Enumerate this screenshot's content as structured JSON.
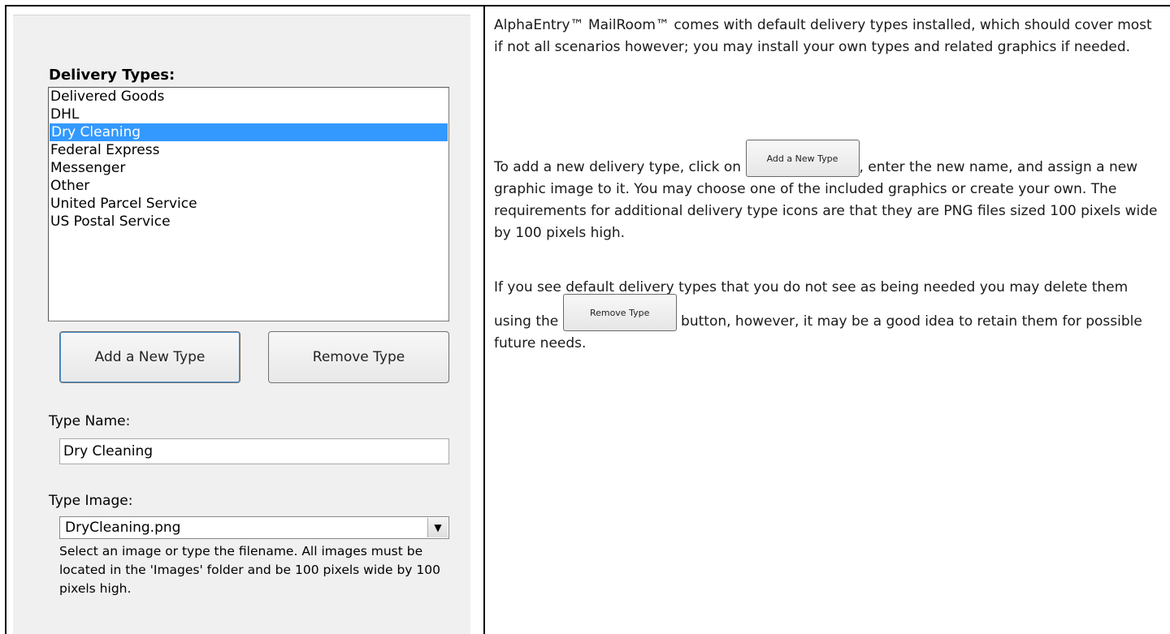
{
  "panel": {
    "delivery_types_label": "Delivery Types:",
    "items": [
      {
        "label": "Delivered Goods",
        "selected": false
      },
      {
        "label": "DHL",
        "selected": false
      },
      {
        "label": "Dry Cleaning",
        "selected": true
      },
      {
        "label": "Federal Express",
        "selected": false
      },
      {
        "label": "Messenger",
        "selected": false
      },
      {
        "label": "Other",
        "selected": false
      },
      {
        "label": "United Parcel Service",
        "selected": false
      },
      {
        "label": "US Postal Service",
        "selected": false
      }
    ],
    "add_button": "Add a New Type",
    "remove_button": "Remove Type",
    "type_name_label": "Type Name:",
    "type_name_value": "Dry Cleaning",
    "type_image_label": "Type Image:",
    "type_image_value": "DryCleaning.png",
    "dropdown_icon": "chevron-down-icon",
    "hint": "Select an image or type the filename. All images must be located in the 'Images' folder and be 100 pixels wide by 100 pixels high."
  },
  "doc": {
    "para1": "AlphaEntry™ MailRoom™ comes with default delivery types installed, which should cover most if not all scenarios however; you may install your own types and related graphics if needed.",
    "para2_before": "To add a new delivery type, click on ",
    "para2_button": "Add a New Type",
    "para2_after": ", enter the new name, and assign a new graphic image to it. You may choose one of the included graphics or create your own. The requirements for additional delivery type icons are that they are PNG files sized 100 pixels wide by 100 pixels high.",
    "para3_before": "If you see default delivery types that you do not see as being needed you may delete them using the ",
    "para3_button": "Remove Type",
    "para3_after": " button, however, it may be a good idea to retain them for possible future needs."
  },
  "colors": {
    "selection": "#3399ff",
    "panel_bg": "#f0f0f0"
  }
}
